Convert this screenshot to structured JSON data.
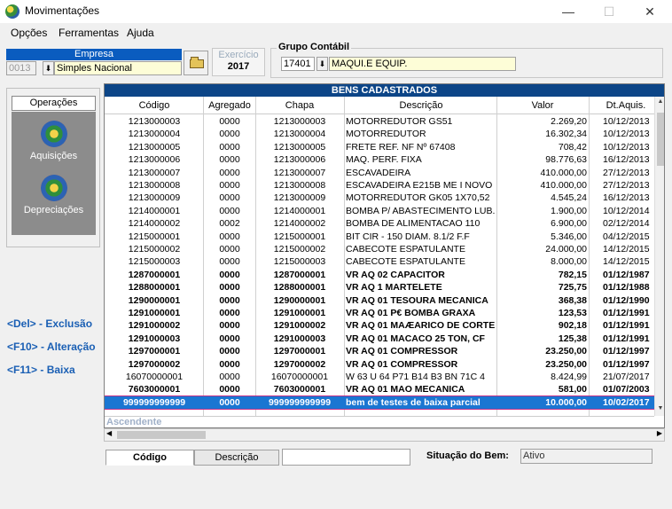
{
  "window": {
    "title": "Movimentações",
    "minimize": "—",
    "maximize": "☐",
    "close": "✕"
  },
  "menu": [
    "Opções",
    "Ferramentas",
    "Ajuda"
  ],
  "empresa": {
    "label": "Empresa",
    "code": "0013",
    "name": "Simples Nacional"
  },
  "exercicio": {
    "label": "Exercício",
    "value": "2017"
  },
  "grupo": {
    "label": "Grupo  Contábil",
    "code": "17401",
    "name": "MAQUI.E EQUIP."
  },
  "operacoes": {
    "label": "Operações",
    "items": [
      "Aquisições",
      "Depreciações"
    ]
  },
  "shortcuts": [
    "<Del> - Exclusão",
    "<F10> - Alteração",
    "<F11> - Baixa"
  ],
  "grid": {
    "caption": "BENS CADASTRADOS",
    "columns": [
      "Código",
      "Agregado",
      "Chapa",
      "Descrição",
      "Valor",
      "Dt.Aquis."
    ],
    "rows": [
      [
        "1213000003",
        "0000",
        "1213000003",
        "MOTORREDUTOR GS51",
        "2.269,20",
        "10/12/2013"
      ],
      [
        "1213000004",
        "0000",
        "1213000004",
        "MOTORREDUTOR",
        "16.302,34",
        "10/12/2013"
      ],
      [
        "1213000005",
        "0000",
        "1213000005",
        "FRETE REF. NF Nº 67408",
        "708,42",
        "10/12/2013"
      ],
      [
        "1213000006",
        "0000",
        "1213000006",
        "MAQ. PERF. FIXA",
        "98.776,63",
        "16/12/2013"
      ],
      [
        "1213000007",
        "0000",
        "1213000007",
        "ESCAVADEIRA",
        "410.000,00",
        "27/12/2013"
      ],
      [
        "1213000008",
        "0000",
        "1213000008",
        "ESCAVADEIRA E215B ME I NOVO",
        "410.000,00",
        "27/12/2013"
      ],
      [
        "1213000009",
        "0000",
        "1213000009",
        "MOTORREDUTOR GK05 1X70,52",
        "4.545,24",
        "16/12/2013"
      ],
      [
        "1214000001",
        "0000",
        "1214000001",
        "BOMBA P/ ABASTECIMENTO LUB.",
        "1.900,00",
        "10/12/2014"
      ],
      [
        "1214000002",
        "0002",
        "1214000002",
        "BOMBA DE ALIMENTACAO 110",
        "6.900,00",
        "02/12/2014"
      ],
      [
        "1215000001",
        "0000",
        "1215000001",
        "BIT CIR - 150 DIAM. 8.1/2 F.F",
        "5.346,00",
        "04/12/2015"
      ],
      [
        "1215000002",
        "0000",
        "1215000002",
        "CABECOTE ESPATULANTE",
        "24.000,00",
        "14/12/2015"
      ],
      [
        "1215000003",
        "0000",
        "1215000003",
        "CABECOTE ESPATULANTE",
        "8.000,00",
        "14/12/2015"
      ],
      [
        "1287000001",
        "0000",
        "1287000001",
        "VR AQ 02 CAPACITOR",
        "782,15",
        "01/12/1987"
      ],
      [
        "1288000001",
        "0000",
        "1288000001",
        "VR AQ 1 MARTELETE",
        "725,75",
        "01/12/1988"
      ],
      [
        "1290000001",
        "0000",
        "1290000001",
        "VR AQ 01 TESOURA MECANICA",
        "368,38",
        "01/12/1990"
      ],
      [
        "1291000001",
        "0000",
        "1291000001",
        "VR AQ 01 P€ BOMBA GRAXA",
        "123,53",
        "01/12/1991"
      ],
      [
        "1291000002",
        "0000",
        "1291000002",
        "VR AQ 01 MAÆARICO DE CORTE",
        "902,18",
        "01/12/1991"
      ],
      [
        "1291000003",
        "0000",
        "1291000003",
        "VR AQ 01 MACACO 25 TON, CF",
        "125,38",
        "01/12/1991"
      ],
      [
        "1297000001",
        "0000",
        "1297000001",
        "VR AQ 01 COMPRESSOR",
        "23.250,00",
        "01/12/1997"
      ],
      [
        "1297000002",
        "0000",
        "1297000002",
        "VR AQ 01 COMPRESSOR",
        "23.250,00",
        "01/12/1997"
      ],
      [
        "16070000001",
        "0000",
        "16070000001",
        "W 63 U 64  P71 B14 B3 BN 71C 4",
        "8.424,99",
        "21/07/2017"
      ],
      [
        "7603000001",
        "0000",
        "7603000001",
        "VR AQ 01 MAO MECANICA",
        "581,00",
        "01/07/2003"
      ],
      [
        "999999999999",
        "0000",
        "999999999999",
        "bem de testes  de  baixa parcial",
        "10.000,00",
        "10/02/2017"
      ]
    ],
    "bold_from": 12,
    "normal_rows_after_bold": [
      20
    ],
    "selected_row": 22,
    "sort_label": "Ascendente"
  },
  "bottom": {
    "tab_codigo": "Código",
    "tab_descricao": "Descrição",
    "search_value": "",
    "situacao_label": "Situação do Bem:",
    "situacao_value": "Ativo"
  },
  "colors": {
    "accent": "#0c4587",
    "selection": "#1a76d2",
    "empresa_header": "#0a5cbf",
    "shortcut_text": "#1a5fb4"
  }
}
